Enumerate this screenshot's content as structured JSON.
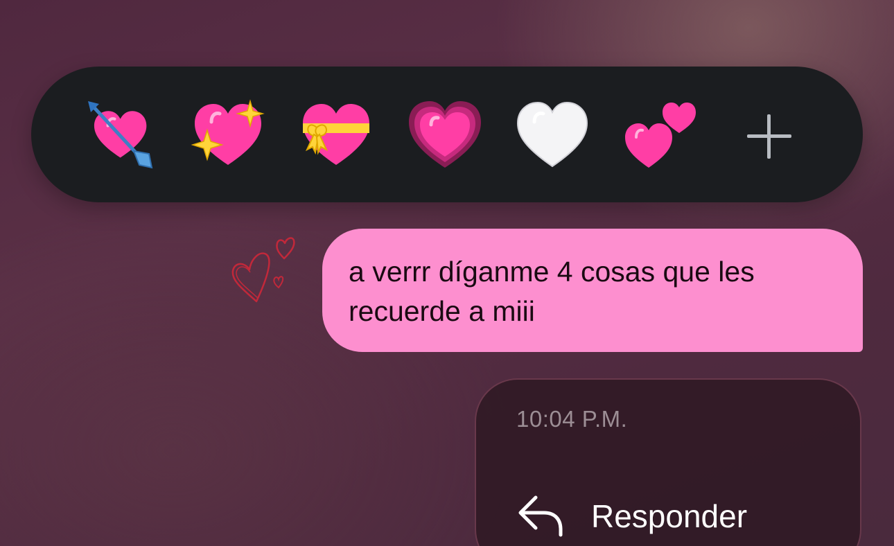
{
  "reaction_bar": {
    "reactions": [
      {
        "name": "heart-with-arrow",
        "emoji": "💘"
      },
      {
        "name": "sparkling-heart",
        "emoji": "💖"
      },
      {
        "name": "heart-with-ribbon",
        "emoji": "💝"
      },
      {
        "name": "growing-heart",
        "emoji": "💗"
      },
      {
        "name": "white-heart",
        "emoji": "🤍"
      },
      {
        "name": "two-hearts",
        "emoji": "💕"
      }
    ],
    "more_icon": "plus-icon",
    "background_color": "#1b1d20"
  },
  "message": {
    "text": "a verrr díganme 4 cosas que les recuerde a miii",
    "bubble_color": "#fd8fcf"
  },
  "context_menu": {
    "timestamp": "10:04 P.M.",
    "reply_label": "Responder",
    "reply_icon": "reply-arrow-icon"
  }
}
